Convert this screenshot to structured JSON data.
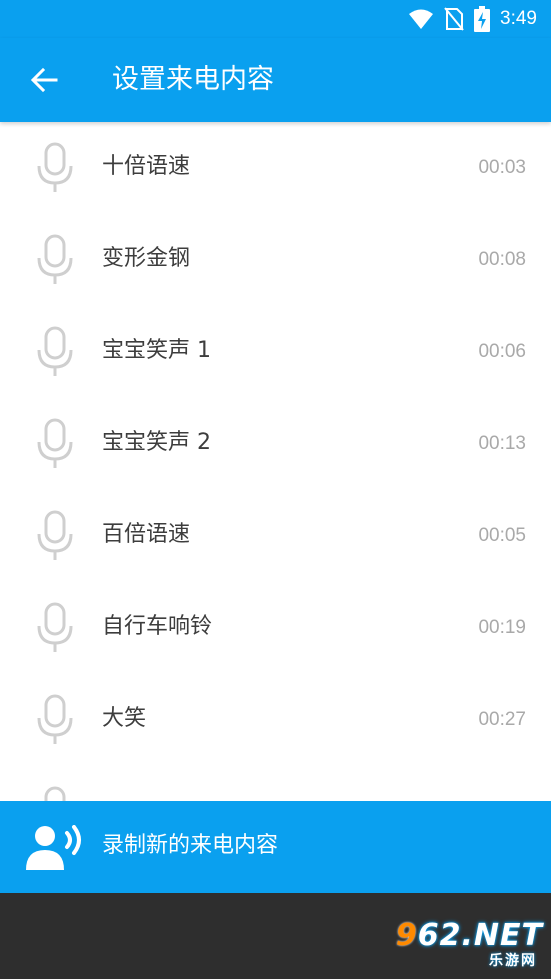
{
  "status_bar": {
    "time": "3:49",
    "icons": [
      "wifi-icon",
      "no-sim-icon",
      "battery-charging-icon"
    ]
  },
  "app_bar": {
    "title": "设置来电内容",
    "back_icon": "arrow-back-icon"
  },
  "list": {
    "items": [
      {
        "name": "十倍语速",
        "duration": "00:03",
        "icon": "microphone-icon"
      },
      {
        "name": "变形金钢",
        "duration": "00:08",
        "icon": "microphone-icon"
      },
      {
        "name": "宝宝笑声 1",
        "duration": "00:06",
        "icon": "microphone-icon"
      },
      {
        "name": "宝宝笑声 2",
        "duration": "00:13",
        "icon": "microphone-icon"
      },
      {
        "name": "百倍语速",
        "duration": "00:05",
        "icon": "microphone-icon"
      },
      {
        "name": "自行车响铃",
        "duration": "00:19",
        "icon": "microphone-icon"
      },
      {
        "name": "大笑",
        "duration": "00:27",
        "icon": "microphone-icon"
      }
    ]
  },
  "record_button": {
    "label": "录制新的来电内容",
    "icon": "voice-record-icon"
  },
  "watermark": {
    "main": "962.NET",
    "sub": "乐游网"
  },
  "colors": {
    "primary": "#0aa0ef",
    "text": "#3d3d3d",
    "duration": "#a9a9a9",
    "icon": "#cfcfcf",
    "bottom": "#2e2e2e"
  }
}
